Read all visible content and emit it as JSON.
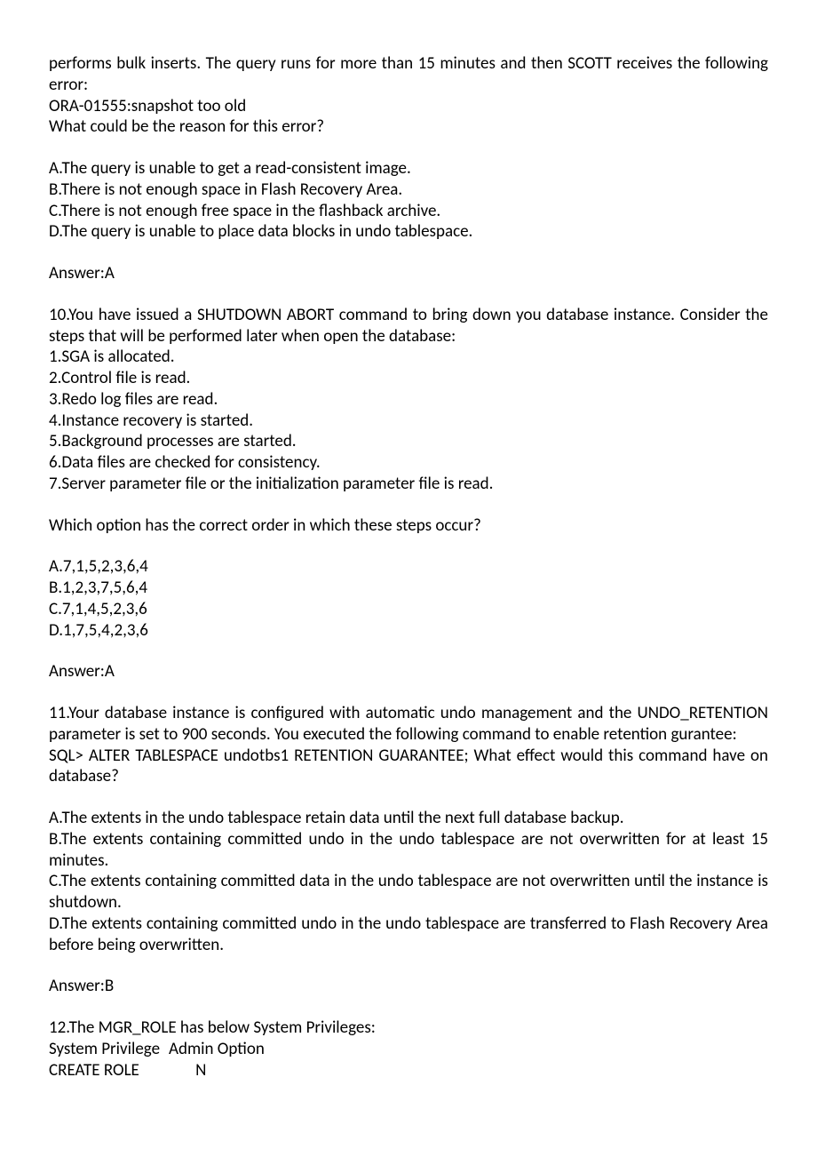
{
  "q9": {
    "stem1": "performs bulk inserts. The query runs for more than 15 minutes and then SCOTT receives the following error:",
    "stem2": "ORA-01555:snapshot too old",
    "stem3": "What could be the reason for this error?",
    "optA": "A.The query is unable to get a read-consistent image.",
    "optB": "B.There is not enough space in Flash Recovery Area.",
    "optC": "C.There is not enough free space in the flashback archive.",
    "optD": "D.The query is unable to place data blocks in undo tablespace.",
    "answer": "Answer:A"
  },
  "q10": {
    "stem1": "10.You have issued a SHUTDOWN ABORT command to bring down you database instance. Consider the steps that will be performed later when open the database:",
    "s1": "1.SGA is allocated.",
    "s2": "2.Control file is read.",
    "s3": "3.Redo log files are read.",
    "s4": "4.Instance recovery is started.",
    "s5": "5.Background processes are started.",
    "s6": "6.Data files are checked for consistency.",
    "s7": "7.Server parameter file or the initialization parameter file is read.",
    "prompt": "Which option has the correct order in which these steps occur?",
    "optA": "A.7,1,5,2,3,6,4",
    "optB": "B.1,2,3,7,5,6,4",
    "optC": "C.7,1,4,5,2,3,6",
    "optD": "D.1,7,5,4,2,3,6",
    "answer": "Answer:A"
  },
  "q11": {
    "stem1": "11.Your database instance is configured with automatic undo management and the UNDO_RETENTION parameter is set to 900 seconds. You executed the following command to enable retention gurantee:",
    "stem2": "SQL> ALTER TABLESPACE undotbs1 RETENTION GUARANTEE; What effect would this command have on database?",
    "optA": "A.The extents in the undo tablespace retain data until the next full database backup.",
    "optB": "B.The extents containing committed undo in the undo tablespace are not overwritten for at least 15 minutes.",
    "optC": "C.The extents containing committed data in the undo tablespace are not overwritten until the instance is shutdown.",
    "optD": "D.The extents containing committed undo in the undo tablespace are transferred to Flash Recovery Area before being overwritten.",
    "answer": "Answer:B"
  },
  "q12": {
    "stem1": "12.The MGR_ROLE has below System Privileges:",
    "hdr_c1": "System Privilege",
    "hdr_c2": "Admin Option",
    "row1_c1": "CREATE ROLE",
    "row1_c2": "N"
  }
}
